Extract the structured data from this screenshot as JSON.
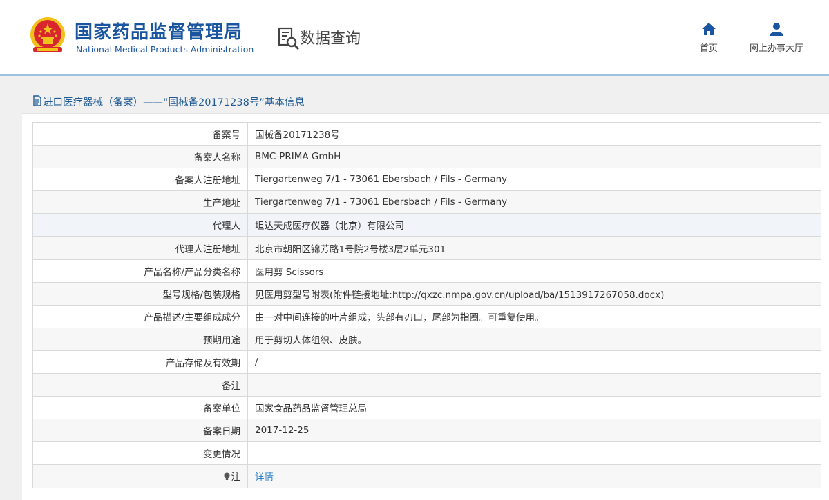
{
  "header": {
    "org_name_cn": "国家药品监督管理局",
    "org_name_en": "National Medical Products Administration",
    "section_title": "数据查询",
    "nav": [
      {
        "label": "首页",
        "icon": "home-icon"
      },
      {
        "label": "网上办事大厅",
        "icon": "user-icon"
      }
    ]
  },
  "panel": {
    "title": "进口医疗器械（备案）——“国械备20171238号”基本信息"
  },
  "rows": [
    {
      "label": "备案号",
      "value": "国械备20171238号"
    },
    {
      "label": "备案人名称",
      "value": "BMC-PRIMA GmbH"
    },
    {
      "label": "备案人注册地址",
      "value": "Tiergartenweg 7/1 - 73061 Ebersbach / Fils - Germany"
    },
    {
      "label": "生产地址",
      "value": "Tiergartenweg 7/1 - 73061 Ebersbach / Fils - Germany"
    },
    {
      "label": "代理人",
      "value": "坦达天成医疗仪器（北京）有限公司"
    },
    {
      "label": "代理人注册地址",
      "value": "北京市朝阳区锦芳路1号院2号楼3层2单元301"
    },
    {
      "label": "产品名称/产品分类名称",
      "value": "医用剪 Scissors"
    },
    {
      "label": "型号规格/包装规格",
      "value": "见医用剪型号附表(附件链接地址:http://qxzc.nmpa.gov.cn/upload/ba/1513917267058.docx)"
    },
    {
      "label": "产品描述/主要组成成分",
      "value": "由一对中间连接的叶片组成，头部有刃口，尾部为指圈。可重复使用。"
    },
    {
      "label": "预期用途",
      "value": "用于剪切人体组织、皮肤。"
    },
    {
      "label": "产品存储及有效期",
      "value": "/"
    },
    {
      "label": "备注",
      "value": ""
    },
    {
      "label": "备案单位",
      "value": "国家食品药品监督管理总局"
    },
    {
      "label": "备案日期",
      "value": "2017-12-25"
    },
    {
      "label": "变更情况",
      "value": ""
    },
    {
      "label": "注",
      "value": "详情",
      "icon": "bulb-icon"
    }
  ],
  "colors": {
    "brand": "#1a56a0",
    "link": "#2a7fc8",
    "emblem_red": "#d9262e",
    "emblem_gold": "#f2c21a"
  }
}
